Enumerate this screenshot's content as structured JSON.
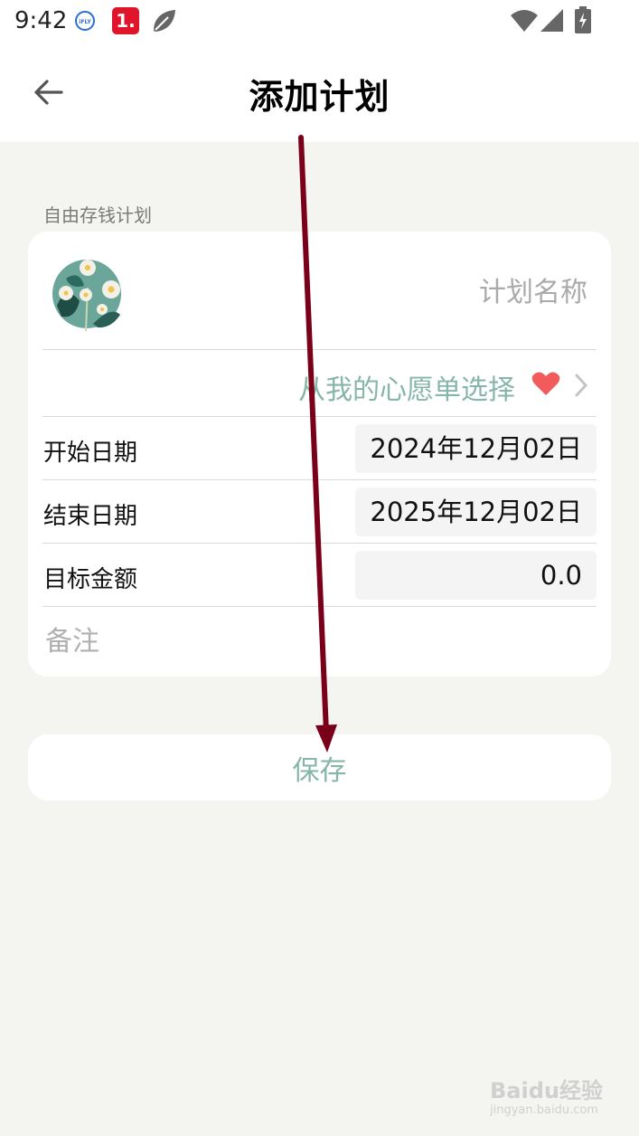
{
  "status_bar": {
    "time": "9:42",
    "ifly_label": "iFLY",
    "badge_label": "1."
  },
  "header": {
    "title": "添加计划"
  },
  "form": {
    "section_label": "自由存钱计划",
    "name_placeholder": "计划名称",
    "wishlist_label": "从我的心愿单选择",
    "start_date_label": "开始日期",
    "start_date_value": "2024年12月02日",
    "end_date_label": "结束日期",
    "end_date_value": "2025年12月02日",
    "target_amount_label": "目标金额",
    "target_amount_value": "0.0",
    "remark_placeholder": "备注"
  },
  "actions": {
    "save_label": "保存"
  },
  "colors": {
    "accent": "#86b5a9",
    "heart": "#f25b5b",
    "background": "#f4f5f0",
    "annotation_arrow": "#7a0019"
  },
  "watermark": {
    "brand": "Baidu经验",
    "sub": "jingyan.baidu.com"
  }
}
